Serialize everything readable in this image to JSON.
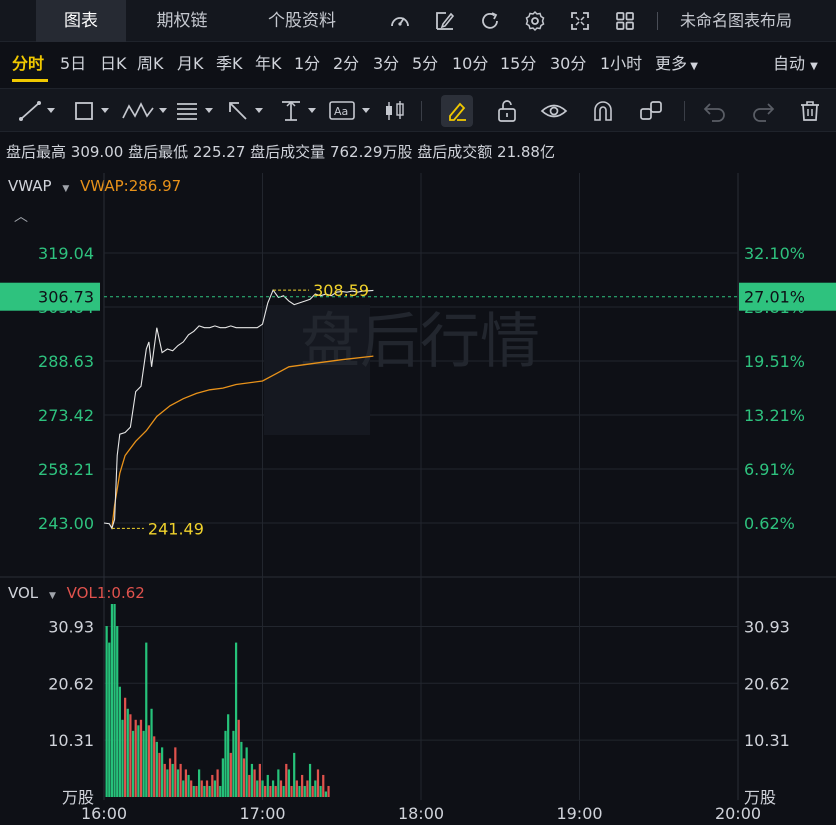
{
  "tabs": [
    {
      "label": "图表",
      "active": true
    },
    {
      "label": "期权链",
      "active": false
    },
    {
      "label": "个股资料",
      "active": false
    }
  ],
  "layout_name": "未命名图表布局",
  "periods": [
    "分时",
    "5日",
    "日K",
    "周K",
    "月K",
    "季K",
    "年K",
    "1分",
    "2分",
    "3分",
    "5分",
    "10分",
    "15分",
    "30分",
    "1小时",
    "更多"
  ],
  "active_period": "分时",
  "auto_label": "自动",
  "info": {
    "high_label": "盘后最高",
    "high": "309.00",
    "low_label": "盘后最低",
    "low": "225.27",
    "vol_label": "盘后成交量",
    "vol": "762.29万股",
    "amt_label": "盘后成交额",
    "amt": "21.88亿"
  },
  "price_panel": {
    "indicator": "VWAP",
    "indicator_value": "VWAP:286.97",
    "watermark": "盘后行情",
    "left_ticks": [
      "319.04",
      "288.63",
      "273.42",
      "258.21",
      "243.00"
    ],
    "right_ticks": [
      "32.10%",
      "19.51%",
      "13.21%",
      "6.91%",
      "0.62%"
    ],
    "current_price": "306.73",
    "current_pct": "27.01%",
    "hidden_left": "303.84",
    "hidden_right": "25.81%",
    "max_marker": "308.59",
    "min_marker": "241.49"
  },
  "vol_panel": {
    "indicator": "VOL",
    "indicator_value": "VOL1:0.62",
    "ticks": [
      "30.93",
      "20.62",
      "10.31"
    ],
    "unit": "万股"
  },
  "time_labels": [
    "16:00",
    "17:00",
    "18:00",
    "19:00",
    "20:00"
  ],
  "colors": {
    "up": "#26c27a",
    "down": "#e0524d",
    "vwap": "#e8921a",
    "price": "#e6e6e6",
    "marker": "#f0d22c",
    "current": "#2ec27e"
  },
  "chart_data": {
    "type": "line",
    "x_range": [
      "16:00",
      "20:00"
    ],
    "y_range": [
      243.0,
      319.04
    ],
    "series": [
      {
        "name": "",
        "x": [
          "16:00",
          "16:02",
          "16:03",
          "16:04",
          "16:05",
          "16:06",
          "16:08",
          "16:10",
          "16:12",
          "16:14",
          "16:16",
          "16:17",
          "16:18",
          "16:20",
          "16:22",
          "16:24",
          "16:26",
          "16:28",
          "16:30",
          "16:32",
          "16:34",
          "16:36",
          "16:38",
          "16:40",
          "16:42",
          "16:44",
          "16:46",
          "16:48",
          "16:50",
          "16:52",
          "16:54",
          "16:56",
          "16:58",
          "17:00",
          "17:02",
          "17:04",
          "17:06",
          "17:08",
          "17:10",
          "17:12",
          "17:14",
          "17:16",
          "17:18",
          "17:20",
          "17:22",
          "17:24",
          "17:26",
          "17:28",
          "17:30",
          "17:32",
          "17:34",
          "17:36",
          "17:38",
          "17:40",
          "17:42"
        ],
        "values": [
          243.0,
          242.8,
          241.5,
          244.0,
          262.0,
          268.0,
          268.5,
          270.0,
          280.0,
          281.5,
          292.0,
          294.0,
          287.0,
          298.0,
          291.0,
          292.0,
          291.5,
          293.0,
          294.0,
          296.0,
          297.0,
          298.5,
          298.0,
          298.0,
          298.5,
          298.0,
          298.0,
          298.5,
          298.0,
          298.0,
          298.0,
          298.0,
          298.0,
          299.0,
          305.0,
          308.6,
          306.5,
          307.0,
          305.5,
          304.5,
          305.0,
          305.5,
          306.0,
          307.5,
          307.0,
          307.5,
          307.0,
          308.0,
          308.2,
          308.0,
          308.3,
          308.0,
          308.3,
          308.4,
          308.5
        ]
      },
      {
        "name": "VWAP",
        "x": [
          "16:03",
          "16:04",
          "16:06",
          "16:08",
          "16:12",
          "16:16",
          "16:20",
          "16:25",
          "16:30",
          "16:35",
          "16:40",
          "16:45",
          "16:50",
          "17:00",
          "17:05",
          "17:10",
          "17:20",
          "17:30",
          "17:42"
        ],
        "values": [
          241.5,
          248.0,
          257.0,
          262.0,
          266.0,
          269.0,
          273.0,
          276.0,
          278.0,
          279.5,
          280.5,
          281.0,
          282.0,
          283.0,
          285.0,
          287.0,
          288.0,
          289.0,
          290.0
        ]
      }
    ],
    "volume": {
      "x_start": "16:01",
      "x_step_min": 1,
      "unit": "万股",
      "ylim": [
        0,
        35
      ],
      "values": [
        31,
        28,
        35,
        35,
        31,
        20,
        14,
        18,
        16,
        15,
        12,
        14,
        13,
        14,
        12,
        28,
        13,
        16,
        11,
        10,
        8,
        9,
        6,
        5,
        7,
        6,
        9,
        5,
        6,
        3,
        5,
        4,
        3,
        2,
        2,
        5,
        3,
        2,
        3,
        2,
        4,
        3,
        5,
        2,
        7,
        12,
        15,
        8,
        12,
        28,
        14,
        10,
        7,
        9,
        4,
        6,
        5,
        3,
        6,
        3,
        2,
        4,
        2,
        3,
        2,
        5,
        3,
        2,
        6,
        5,
        2,
        8,
        3,
        2,
        4,
        2,
        3,
        6,
        2,
        3,
        5,
        2,
        4,
        1,
        2
      ],
      "directions": [
        "up",
        "up",
        "up",
        "up",
        "up",
        "up",
        "up",
        "down",
        "up",
        "down",
        "up",
        "down",
        "up",
        "down",
        "up",
        "up",
        "down",
        "up",
        "down",
        "up",
        "down",
        "up",
        "down",
        "up",
        "down",
        "up",
        "down",
        "up",
        "down",
        "up",
        "down",
        "up",
        "down",
        "up",
        "down",
        "up",
        "down",
        "up",
        "down",
        "up",
        "down",
        "up",
        "down",
        "up",
        "up",
        "up",
        "up",
        "down",
        "up",
        "up",
        "down",
        "up",
        "down",
        "up",
        "down",
        "up",
        "down",
        "up",
        "down",
        "up",
        "down",
        "up",
        "down",
        "up",
        "down",
        "up",
        "down",
        "up",
        "down",
        "up",
        "down",
        "up",
        "down",
        "up",
        "down",
        "up",
        "down",
        "up",
        "down",
        "up",
        "down",
        "up",
        "down",
        "up",
        "down"
      ]
    }
  }
}
